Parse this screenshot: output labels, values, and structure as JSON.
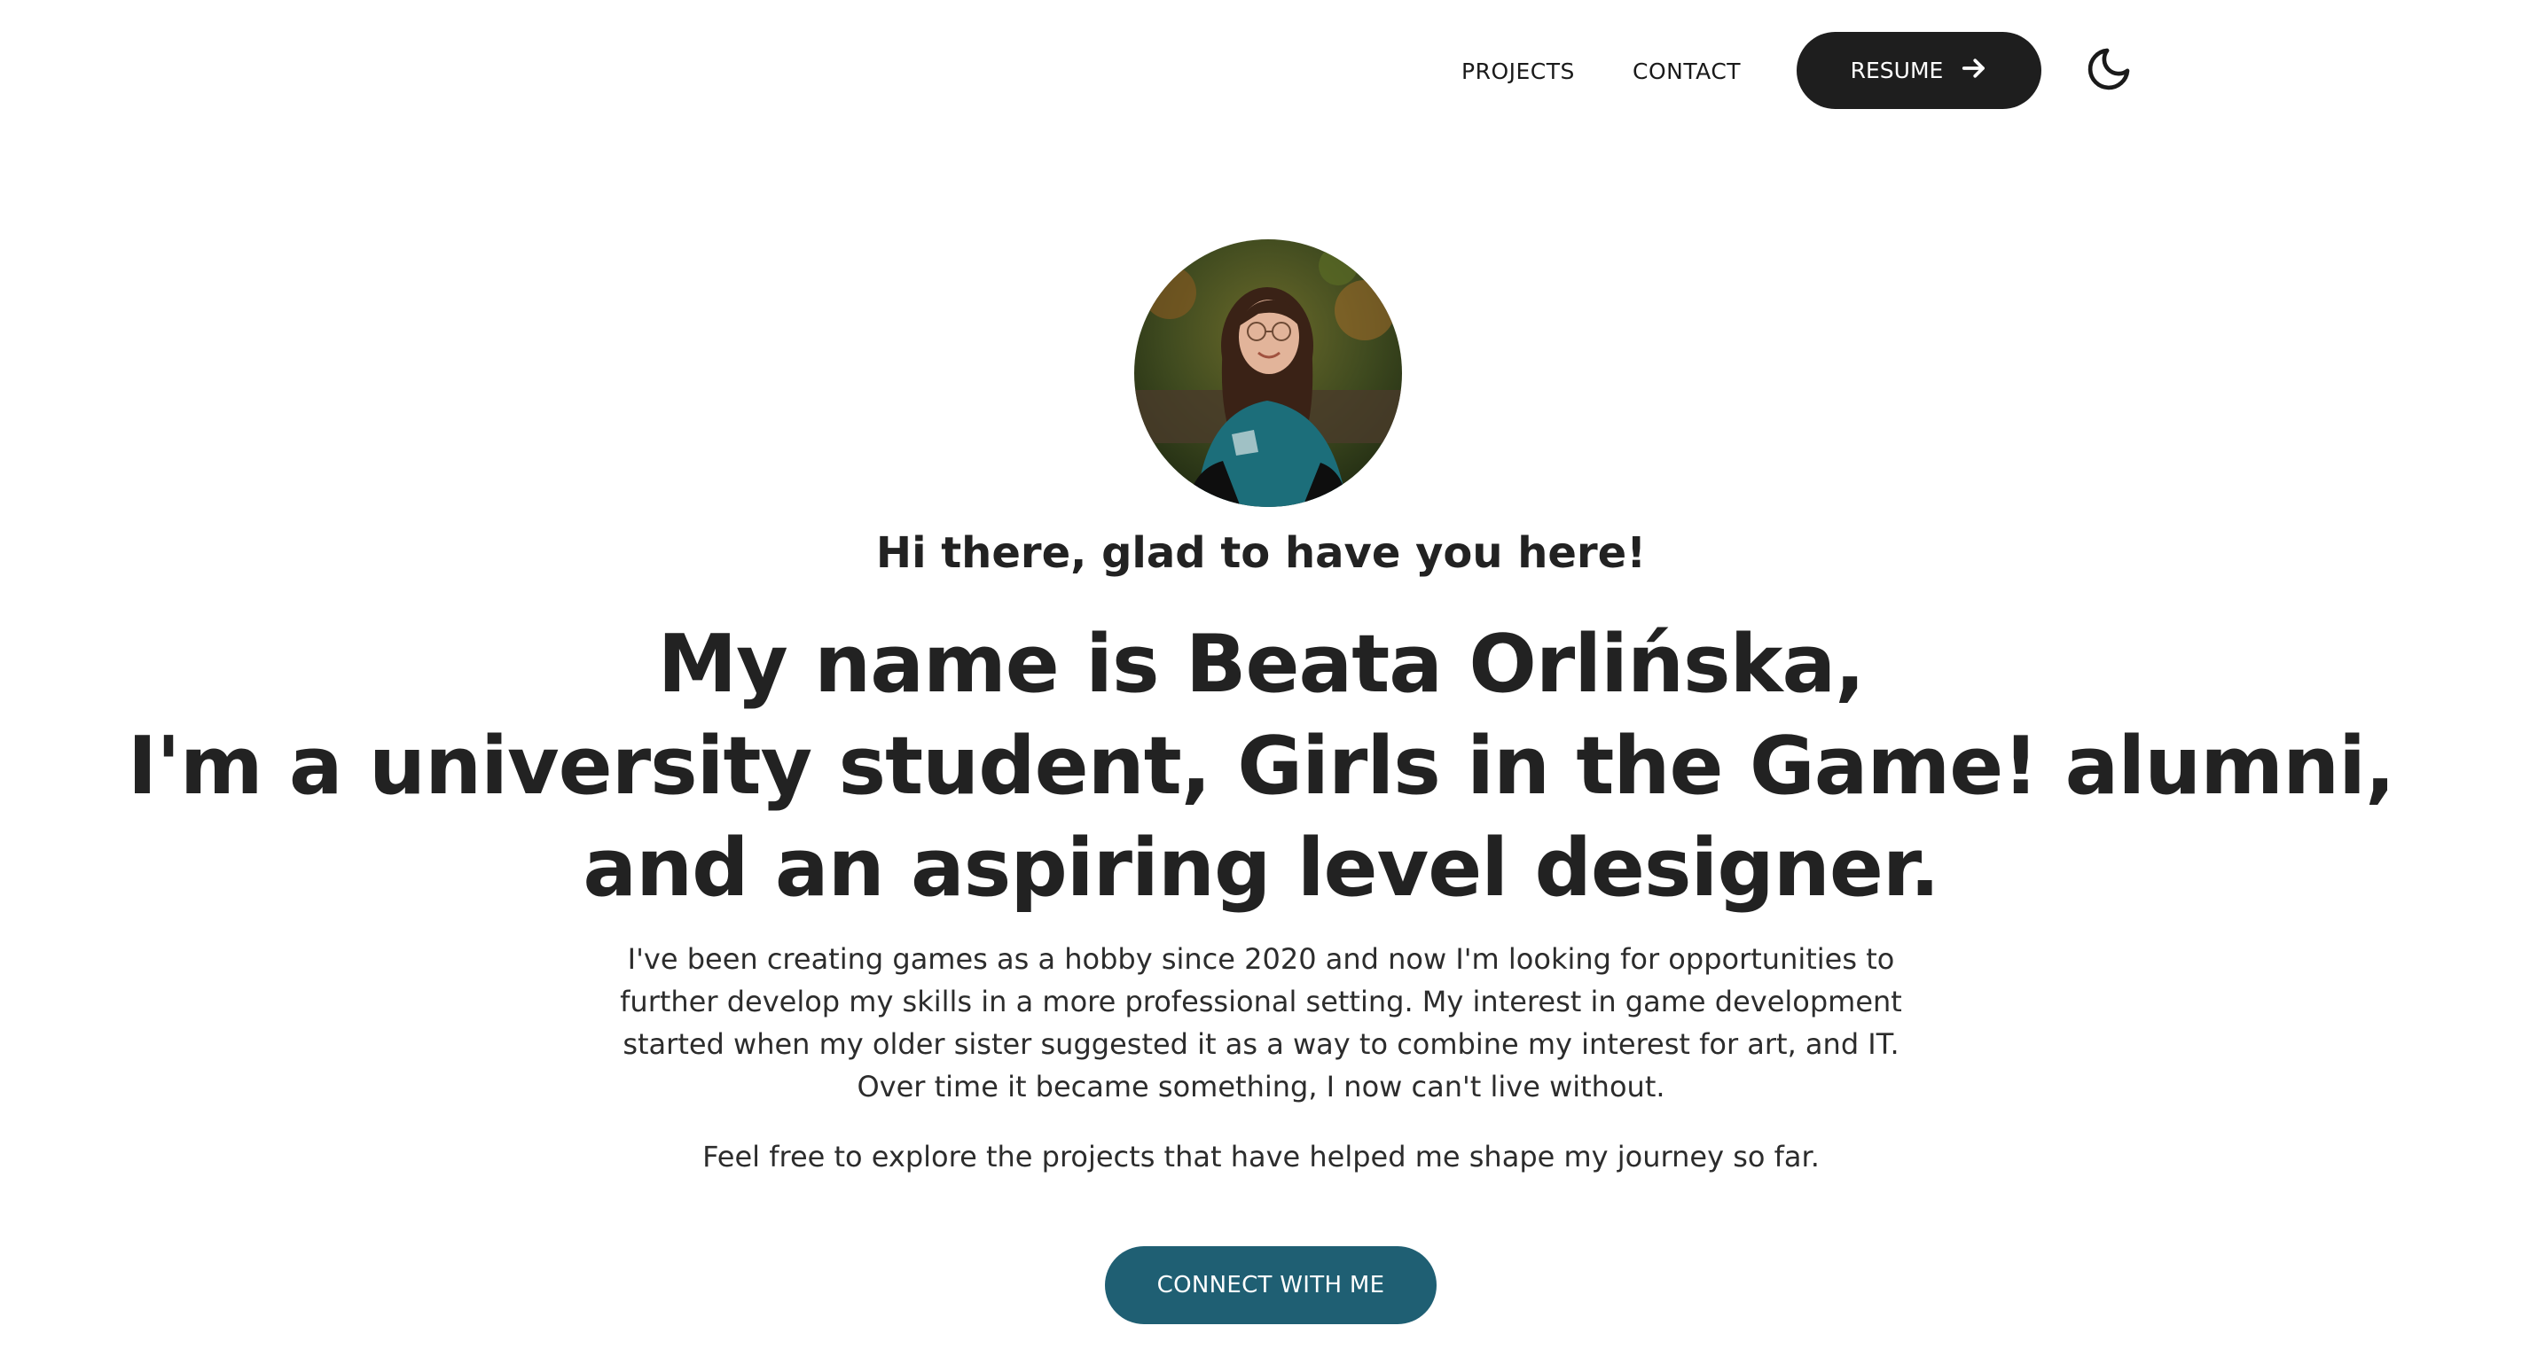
{
  "nav": {
    "projects_label": "PROJECTS",
    "contact_label": "CONTACT",
    "resume_label": "RESUME",
    "resume_icon": "arrow-right-icon",
    "theme_icon": "moon-icon"
  },
  "hero": {
    "greeting": "Hi there, glad to have you here!",
    "headline_lines": [
      "My name is Beata Orlińska,",
      "I'm a university student, Girls in the Game! alumni,",
      "and an aspiring level designer."
    ],
    "intro_lines": [
      "I've been creating games as a hobby since 2020 and now I'm looking for opportunities to",
      "further develop my skills in a more professional setting. My interest in game development",
      "started when my older sister suggested it as a way to combine my interest for art, and IT.",
      "Over time it became something, I now can't live without."
    ],
    "explore_text": "Feel free to explore the projects that have helped me shape my journey so far.",
    "connect_label": "CONNECT WITH ME"
  },
  "colors": {
    "background": "#ffffff",
    "text": "#222222",
    "resume_button": "#1e1e1e",
    "connect_button": "#1f5f73"
  }
}
